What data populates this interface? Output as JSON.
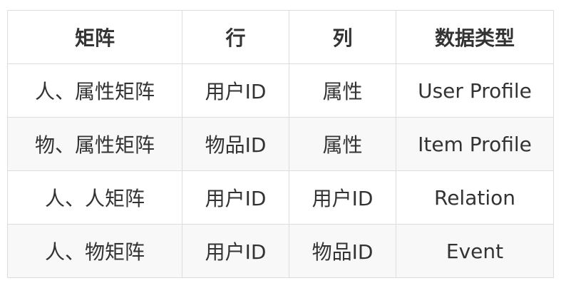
{
  "table": {
    "headers": [
      "矩阵",
      "行",
      "列",
      "数据类型"
    ],
    "rows": [
      [
        "人、属性矩阵",
        "用户ID",
        "属性",
        "User Profile"
      ],
      [
        "物、属性矩阵",
        "物品ID",
        "属性",
        "Item Profile"
      ],
      [
        "人、人矩阵",
        "用户ID",
        "用户ID",
        "Relation"
      ],
      [
        "人、物矩阵",
        "用户ID",
        "物品ID",
        "Event"
      ]
    ]
  }
}
